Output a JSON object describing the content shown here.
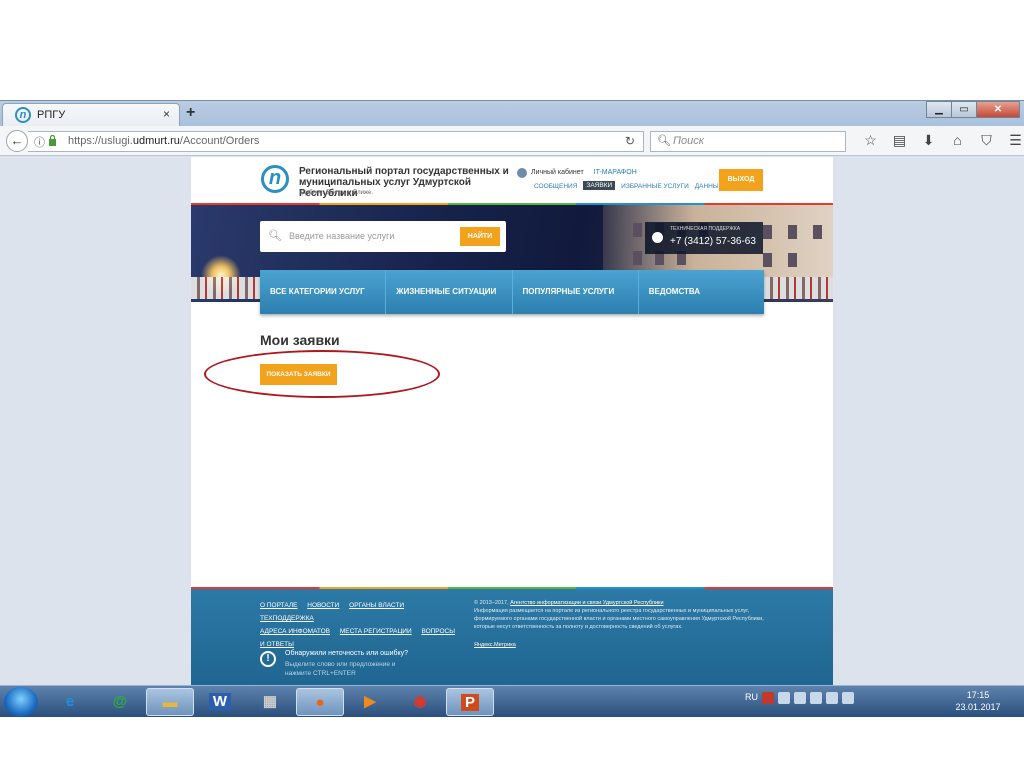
{
  "browser": {
    "tab_title": "РПГУ",
    "tab_close": "×",
    "new_tab": "+",
    "url_prefix": "https://uslugi.",
    "url_domain": "udmurt.ru",
    "url_path": "/Account/Orders",
    "search_placeholder": "Поиск"
  },
  "header": {
    "logo_title": "Региональный портал государственных и муниципальных услуг Удмуртской Республики",
    "tagline": "Удобнее. Быстрее. Ближе.",
    "cabinet": "Личный кабинет",
    "marathon": "IT-МАРАФОН",
    "tabs": [
      "СООБЩЕНИЯ",
      "ЗАЯВКИ",
      "ИЗБРАННЫЕ УСЛУГИ",
      "ДАННЫЕ"
    ],
    "active_tab": "ЗАЯВКИ",
    "logout": "ВЫХОД"
  },
  "banner": {
    "search_placeholder": "Введите название услуги",
    "search_button": "НАЙТИ",
    "support_label": "ТЕХНИЧЕСКАЯ ПОДДЕРЖКА",
    "support_phone": "+7 (3412) 57-36-63"
  },
  "menu": [
    "ВСЕ КАТЕГОРИИ УСЛУГ",
    "ЖИЗНЕННЫЕ СИТУАЦИИ",
    "ПОПУЛЯРНЫЕ УСЛУГИ",
    "ВЕДОМСТВА"
  ],
  "main": {
    "title": "Мои заявки",
    "show_button": "ПОКАЗАТЬ ЗАЯВКИ"
  },
  "footer": {
    "links": [
      "О ПОРТАЛЕ",
      "НОВОСТИ",
      "ОРГАНЫ ВЛАСТИ",
      "ТЕХПОДДЕРЖКА",
      "АДРЕСА ИНФОМАТОВ",
      "МЕСТА РЕГИСТРАЦИИ",
      "ВОПРОСЫ И ОТВЕТЫ"
    ],
    "copyright_prefix": "© 2013–2017,",
    "copyright_agency": "Агентство информатизации и связи Удмуртской Республики",
    "copyright_text": "Информация размещается на портале из регионального реестра государственных и муниципальных услуг, формируемого органами государственной власти и органами местного самоуправления Удмуртской Республики, которые несут ответственность за полноту и достоверность сведений об услугах.",
    "metrika": "Яндекс.Метрика",
    "error_title": "Обнаружили неточность или ошибку?",
    "error_text": "Выделите слово или предложение и нажмите CTRL+ENTER"
  },
  "taskbar": {
    "lang": "RU",
    "time": "17:15",
    "date": "23.01.2017"
  },
  "colors": {
    "accent": "#f2a21b",
    "menu_blue": "#2c7fae",
    "footer_blue": "#1f6591",
    "highlight": "#b0161c"
  }
}
